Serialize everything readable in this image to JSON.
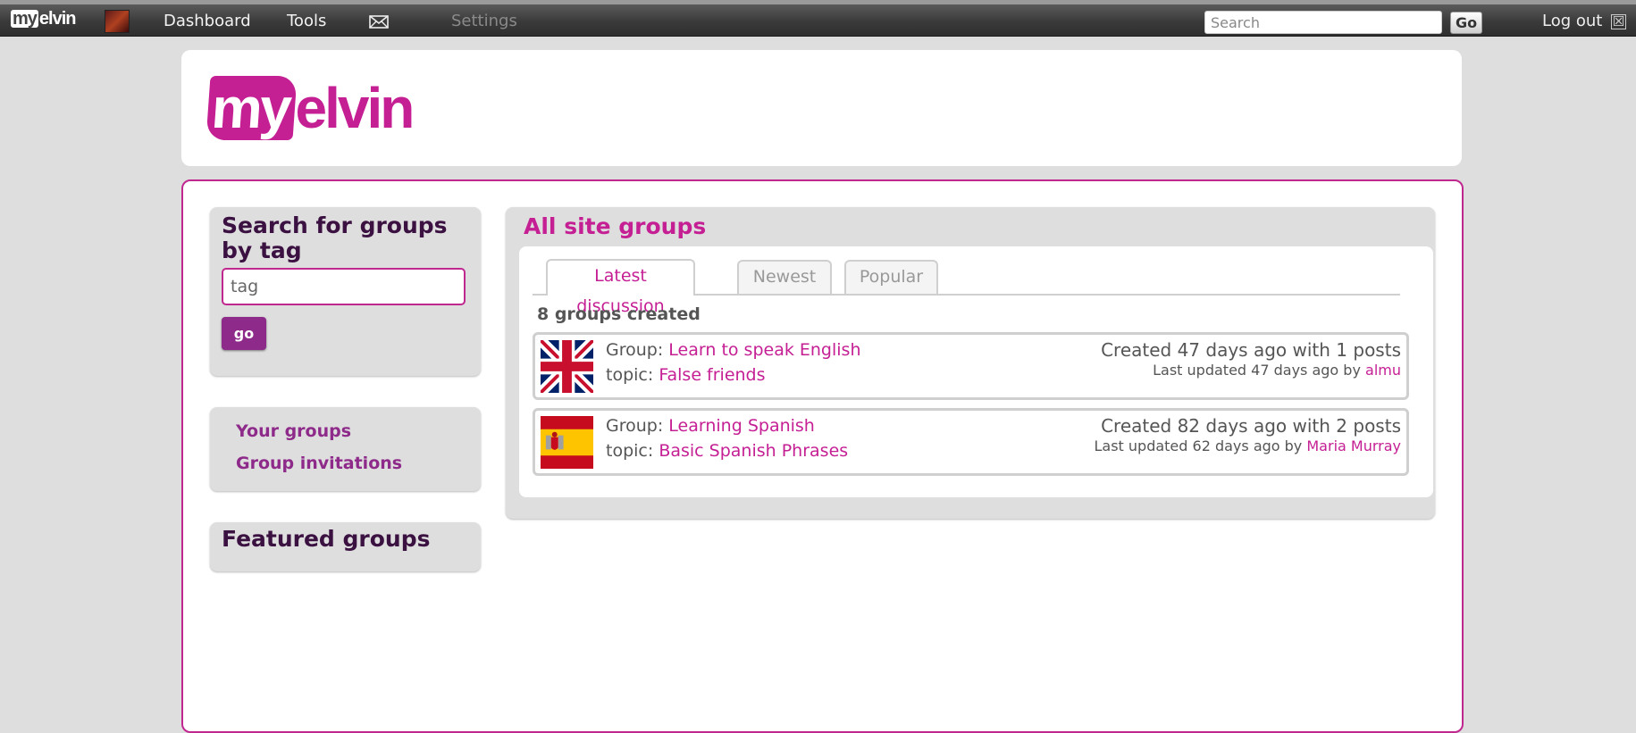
{
  "topbar": {
    "logo_my": "my",
    "logo_rest": "elvin",
    "nav": [
      "Dashboard",
      "Tools",
      "Settings"
    ],
    "search_placeholder": "Search",
    "go_label": "Go",
    "logout_label": "Log out",
    "logout_icon": "☒"
  },
  "header": {
    "brand_my": "my",
    "brand_rest": "elvin",
    "brand_color": "#c51f94"
  },
  "sidebar": {
    "search_title": "Search for groups by tag",
    "tag_placeholder": "tag",
    "go_label": "go",
    "links": [
      "Your groups",
      "Group invitations"
    ],
    "featured_title": "Featured groups"
  },
  "groups": {
    "title": "All site groups",
    "tabs": [
      "Latest discussion",
      "Newest",
      "Popular"
    ],
    "active_tab": "Latest discussion",
    "count_text": "8 groups created",
    "items": [
      {
        "flag": "uk-flag-icon",
        "group_prefix": "Group:",
        "group_name": "Learn to speak English",
        "topic_prefix": "topic:",
        "topic_name": "False friends",
        "created": "Created 47 days ago with 1 posts",
        "updated_prefix": "Last updated 47 days ago by",
        "updated_by": "almu"
      },
      {
        "flag": "spain-flag-icon",
        "group_prefix": "Group:",
        "group_name": "Learning Spanish",
        "topic_prefix": "topic:",
        "topic_name": "Basic Spanish Phrases",
        "created": "Created 82 days ago with 2 posts",
        "updated_prefix": "Last updated 62 days ago by",
        "updated_by": "Maria Murray"
      }
    ]
  }
}
